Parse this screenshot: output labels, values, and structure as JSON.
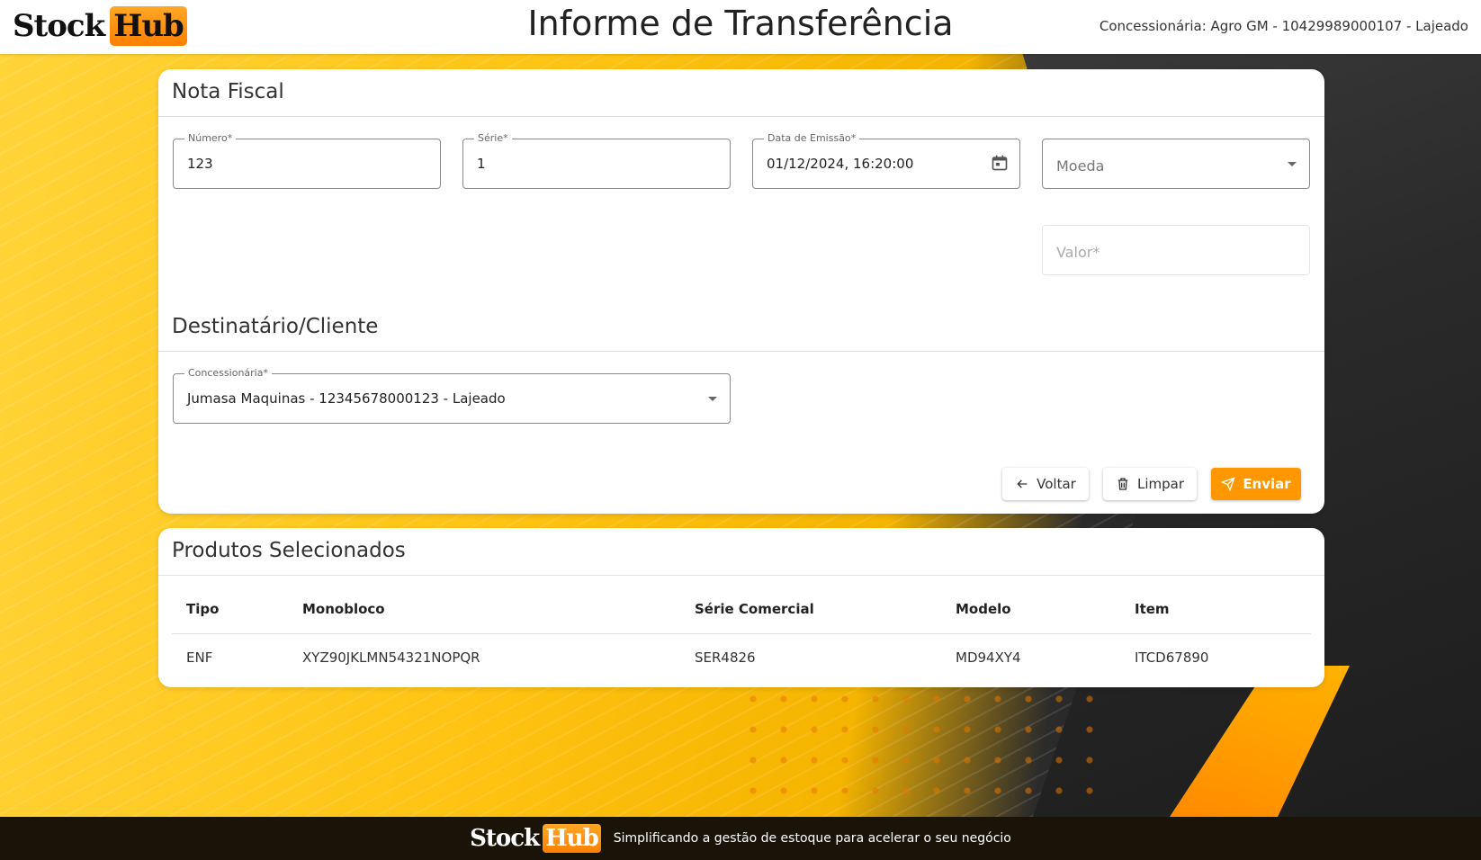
{
  "header": {
    "logo_part1": "Stock",
    "logo_part2": "Hub",
    "title": "Informe de Transferência",
    "dealer": "Concessionária: Agro GM - 10429989000107 - Lajeado"
  },
  "nota_fiscal": {
    "title": "Nota Fiscal",
    "numero": {
      "label": "Número*",
      "value": "123"
    },
    "serie": {
      "label": "Série*",
      "value": "1"
    },
    "data_emissao": {
      "label": "Data de Emissão*",
      "value": "01/12/2024, 16:20:00",
      "icon": "calendar-icon"
    },
    "moeda": {
      "placeholder": "Moeda",
      "icon": "chevron-down-icon"
    },
    "valor": {
      "placeholder": "Valor*"
    }
  },
  "destinatario": {
    "title": "Destinatário/Cliente",
    "concessionaria": {
      "label": "Concessionária*",
      "value": "Jumasa Maquinas - 12345678000123 - Lajeado"
    }
  },
  "actions": {
    "voltar": "Voltar",
    "limpar": "Limpar",
    "enviar": "Enviar"
  },
  "produtos": {
    "title": "Produtos Selecionados",
    "columns": [
      "Tipo",
      "Monobloco",
      "Série Comercial",
      "Modelo",
      "Item"
    ],
    "rows": [
      [
        "ENF",
        "XYZ90JKLMN54321NOPQR",
        "SER4826",
        "MD94XY4",
        "ITCD67890"
      ]
    ]
  },
  "footer": {
    "logo_part1": "Stock",
    "logo_part2": "Hub",
    "tagline": "Simplificando a gestão de estoque para acelerar o seu negócio"
  },
  "colors": {
    "accent": "#ff9800",
    "background_yellow": "#ffc414",
    "footer_bg": "#1a1408"
  }
}
